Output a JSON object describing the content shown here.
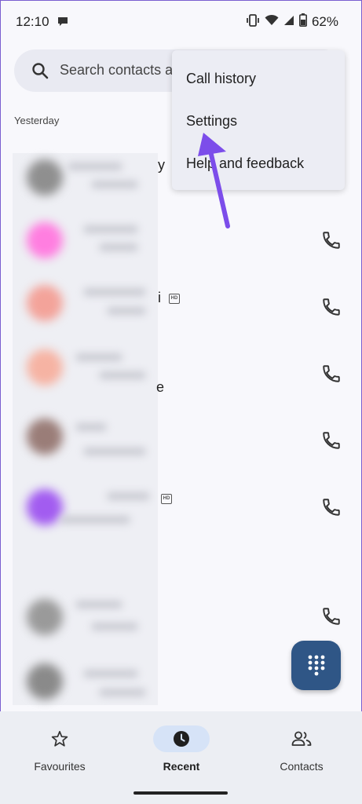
{
  "status_bar": {
    "time": "12:10",
    "battery": "62%"
  },
  "search": {
    "placeholder": "Search contacts a"
  },
  "recents": {
    "section": "Yesterday",
    "fragments": [
      "y",
      "i",
      "e"
    ]
  },
  "overflow_menu": {
    "items": [
      "Call history",
      "Settings",
      "Help and feedback"
    ]
  },
  "fab": {
    "icon": "dialpad-icon"
  },
  "bottom_nav": {
    "items": [
      {
        "label": "Favourites",
        "icon": "star-icon"
      },
      {
        "label": "Recent",
        "icon": "clock-icon",
        "active": true
      },
      {
        "label": "Contacts",
        "icon": "people-icon"
      }
    ]
  },
  "colors": {
    "accent": "#2f5686",
    "annotation_arrow": "#7c4dea",
    "active_pill": "#d6e3f7"
  }
}
